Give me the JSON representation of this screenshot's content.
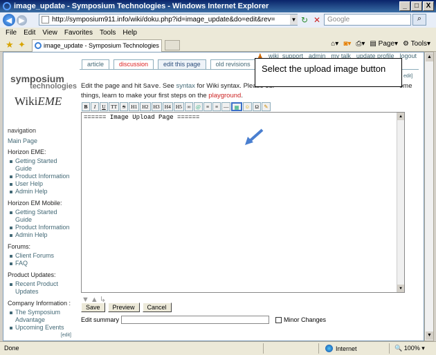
{
  "window": {
    "title": "image_update - Symposium Technologies - Windows Internet Explorer",
    "min": "_",
    "max": "□",
    "close": "X"
  },
  "address": {
    "url": "http://symposium911.info/wiki/doku.php?id=image_update&do=edit&rev=",
    "search_placeholder": "Google"
  },
  "menu": [
    "File",
    "Edit",
    "View",
    "Favorites",
    "Tools",
    "Help"
  ],
  "browser_tab": {
    "label": "image_update - Symposium Technologies"
  },
  "command_bar": {
    "page": "Page",
    "tools": "Tools"
  },
  "userlinks": [
    "wiki_support",
    "admin",
    "my talk",
    "update profile",
    "logout"
  ],
  "logo": {
    "line1": "symposium",
    "line2": "technologies",
    "line3a": "Wiki",
    "line3b": "EME"
  },
  "page_tabs": [
    {
      "label": "article"
    },
    {
      "label": "discussion"
    },
    {
      "label": "edit this page"
    },
    {
      "label": "old revisions"
    }
  ],
  "intro": {
    "t1": "Edit the page and hit ",
    "save_word": "Save",
    "t2": ". See ",
    "syntax": "syntax",
    "t3": " for Wiki syntax. Please edi",
    "t4": "ome",
    "t5": "things, learn to make your first steps on the ",
    "playground": "playground",
    "t6": ".",
    "edit": "edit]"
  },
  "toolbar_buttons": [
    "B",
    "I",
    "U",
    "TT",
    "S",
    "H1",
    "H2",
    "H3",
    "H4",
    "H5",
    "∞",
    "@",
    "≡",
    "≡",
    "—",
    "▦",
    "☺",
    "Ω",
    "✎"
  ],
  "editor": {
    "content": "====== Image Upload Page ======"
  },
  "navigation": {
    "title": "navigation",
    "main_page": "Main Page",
    "sections": [
      {
        "title": "Horizon EME:",
        "items": [
          "Getting Started Guide",
          "Product Information",
          "User Help",
          "Admin Help"
        ]
      },
      {
        "title": "Horizon EM Mobile:",
        "items": [
          "Getting Started Guide",
          "Product Information",
          "Admin Help"
        ]
      },
      {
        "title": "Forums:",
        "items": [
          "Client Forums",
          "FAQ"
        ]
      },
      {
        "title": "Product Updates:",
        "items": [
          "Recent Product Updates"
        ]
      },
      {
        "title": "Company Information :",
        "items": [
          "The Symposium Advantage",
          "Upcoming Events"
        ]
      }
    ],
    "edit": "[edit]"
  },
  "form": {
    "save": "Save",
    "preview": "Preview",
    "cancel": "Cancel",
    "summary_label": "Edit summary",
    "minor": "Minor Changes"
  },
  "callout": {
    "text": "Select the upload image button"
  },
  "status": {
    "done": "Done",
    "zone": "Internet",
    "zoom": "100%"
  },
  "colors": {
    "link": "#436976",
    "title_bar": "#0a246a",
    "highlight": "#3a6fc8"
  }
}
